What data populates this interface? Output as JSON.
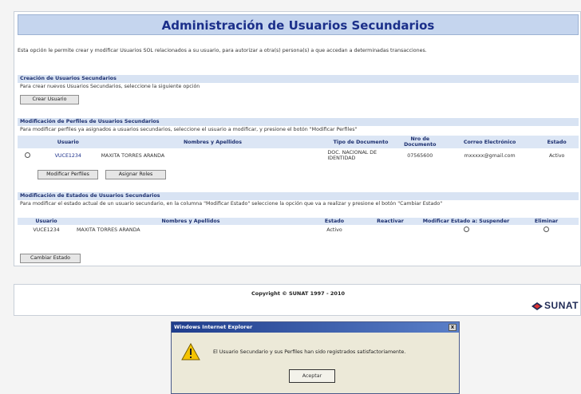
{
  "title": "Administración de Usuarios Secundarios",
  "intro": "Esta opción le permite crear y modificar Usuarios SOL relacionados a su usuario, para autorizar a otra(s) persona(s) a que accedan a determinadas transacciones.",
  "creation": {
    "heading": "Creación de Usuarios Secundarios",
    "text": "Para crear nuevos Usuarios Secundarios, seleccione la siguiente opción",
    "button": "Crear Usuario"
  },
  "profiles": {
    "heading": "Modificación de Perfiles de Usuarios Secundarios",
    "text": "Para modificar perfiles ya asignados a usuarios secundarios, seleccione el usuario a modificar, y presione el botón \"Modificar Perfiles\"",
    "columns": [
      "Usuario",
      "Nombres y Apellidos",
      "Tipo de Documento",
      "Nro de Documento",
      "Correo Electrónico",
      "Estado"
    ],
    "row": {
      "usuario": "VUCE1234",
      "nombre": "MAXITA TORRES ARANDA",
      "tipo": "DOC. NACIONAL DE IDENTIDAD",
      "nro": "07565600",
      "correo": "mxxxxx@gmail.com",
      "estado": "Activo"
    },
    "btn_modify": "Modificar Perfiles",
    "btn_roles": "Asignar Roles"
  },
  "states": {
    "heading": "Modificación de Estados de Usuarios Secundarios",
    "text": "Para modificar el estado actual de un usuario secundario, en la columna \"Modificar Estado\" seleccione la opción que va a realizar y presione el botón \"Cambiar Estado\"",
    "columns": [
      "Usuario",
      "Nombres y Apellidos",
      "Estado",
      "Reactivar",
      "Modificar Estado a: Suspender",
      "Eliminar"
    ],
    "row": {
      "usuario": "VUCE1234",
      "nombre": "MAXITA TORRES ARANDA",
      "estado": "Activo"
    },
    "button": "Cambiar Estado"
  },
  "footer": {
    "copyright": "Copyright © SUNAT 1997 - 2010",
    "logo": "SUNAT"
  },
  "dialog": {
    "title": "Windows Internet Explorer",
    "message": "El Usuario Secundario y sus Perfiles han sido registrados satisfactoriamente.",
    "button": "Aceptar",
    "close": "x"
  }
}
